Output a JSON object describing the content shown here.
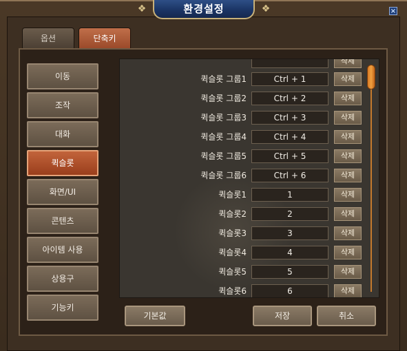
{
  "window": {
    "title": "환경설정",
    "close_label": "×"
  },
  "tabs": [
    {
      "label": "옵션",
      "active": false
    },
    {
      "label": "단축키",
      "active": true
    }
  ],
  "categories": [
    {
      "label": "이동"
    },
    {
      "label": "조작"
    },
    {
      "label": "대화"
    },
    {
      "label": "퀵슬롯",
      "selected": true
    },
    {
      "label": "화면/UI"
    },
    {
      "label": "콘텐츠"
    },
    {
      "label": "아이템 사용"
    },
    {
      "label": "상용구"
    },
    {
      "label": "기능키"
    }
  ],
  "shortcuts": {
    "delete_label": "삭제",
    "rows": [
      {
        "label": "퀵슬롯 그룹1",
        "key": "Ctrl + 1"
      },
      {
        "label": "퀵슬롯 그룹2",
        "key": "Ctrl + 2"
      },
      {
        "label": "퀵슬롯 그룹3",
        "key": "Ctrl + 3"
      },
      {
        "label": "퀵슬롯 그룹4",
        "key": "Ctrl + 4"
      },
      {
        "label": "퀵슬롯 그룹5",
        "key": "Ctrl + 5"
      },
      {
        "label": "퀵슬롯 그룹6",
        "key": "Ctrl + 6"
      },
      {
        "label": "퀵슬롯1",
        "key": "1"
      },
      {
        "label": "퀵슬롯2",
        "key": "2"
      },
      {
        "label": "퀵슬롯3",
        "key": "3"
      },
      {
        "label": "퀵슬롯4",
        "key": "4"
      },
      {
        "label": "퀵슬롯5",
        "key": "5"
      },
      {
        "label": "퀵슬롯6",
        "key": "6"
      }
    ]
  },
  "buttons": {
    "default_label": "기본값",
    "save_label": "저장",
    "cancel_label": "취소"
  },
  "colors": {
    "selected_category": "#b0522c",
    "active_tab": "#ad5b38",
    "title_plate": "#1f3a6c",
    "scroll_thumb": "#e08a30"
  }
}
